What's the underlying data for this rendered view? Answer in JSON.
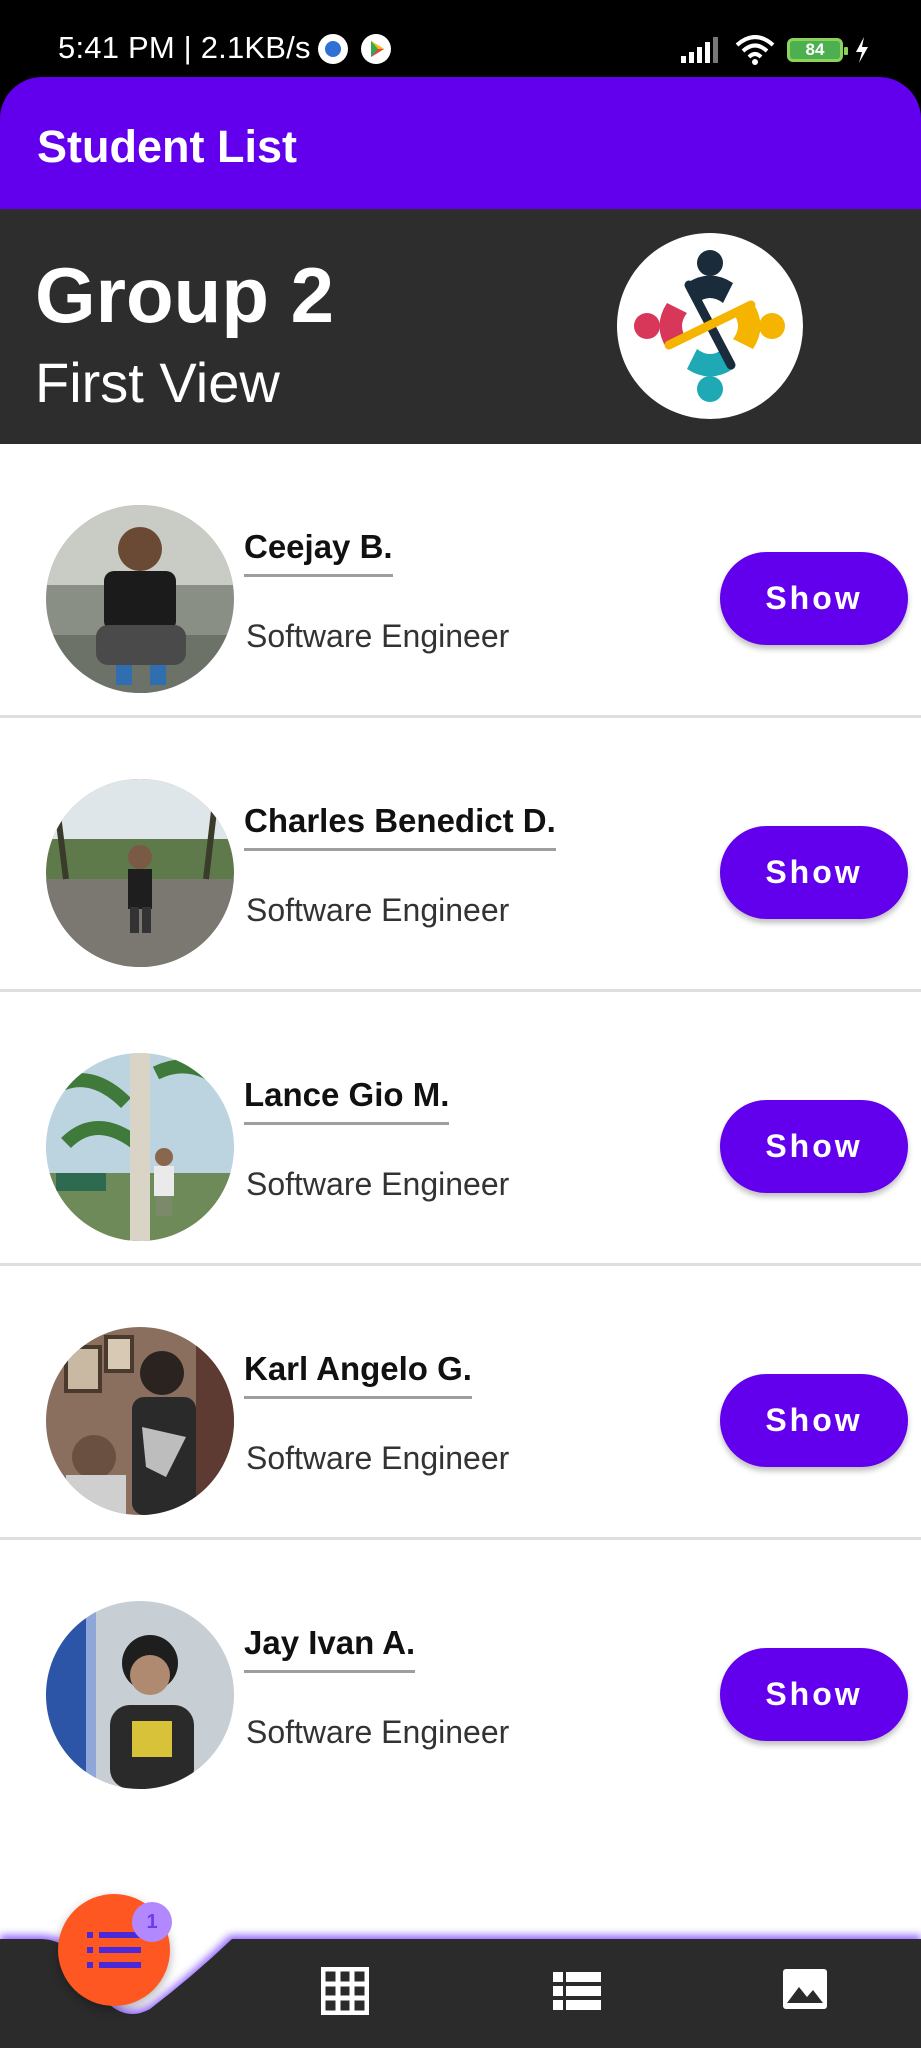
{
  "status_bar": {
    "time": "5:41 PM | 2.1KB/s",
    "battery": "84"
  },
  "app_bar": {
    "title": "Student List"
  },
  "header": {
    "group": "Group 2",
    "subtitle": "First View"
  },
  "students": [
    {
      "name": "Ceejay B.",
      "role": "Software Engineer",
      "button": "Show"
    },
    {
      "name": "Charles Benedict D.",
      "role": "Software Engineer",
      "button": "Show"
    },
    {
      "name": "Lance Gio M.",
      "role": "Software Engineer",
      "button": "Show"
    },
    {
      "name": "Karl Angelo G.",
      "role": "Software Engineer",
      "button": "Show"
    },
    {
      "name": "Jay Ivan A.",
      "role": "Software Engineer",
      "button": "Show"
    }
  ],
  "bottom_nav": {
    "items": [
      "list-bullet-icon",
      "grid-icon",
      "table-list-icon",
      "image-icon"
    ],
    "badge": "1"
  },
  "colors": {
    "primary": "#6200ee",
    "header_bg": "#2d2d2d",
    "fab": "#ff5722",
    "nav_bg": "#2b2b2b"
  }
}
